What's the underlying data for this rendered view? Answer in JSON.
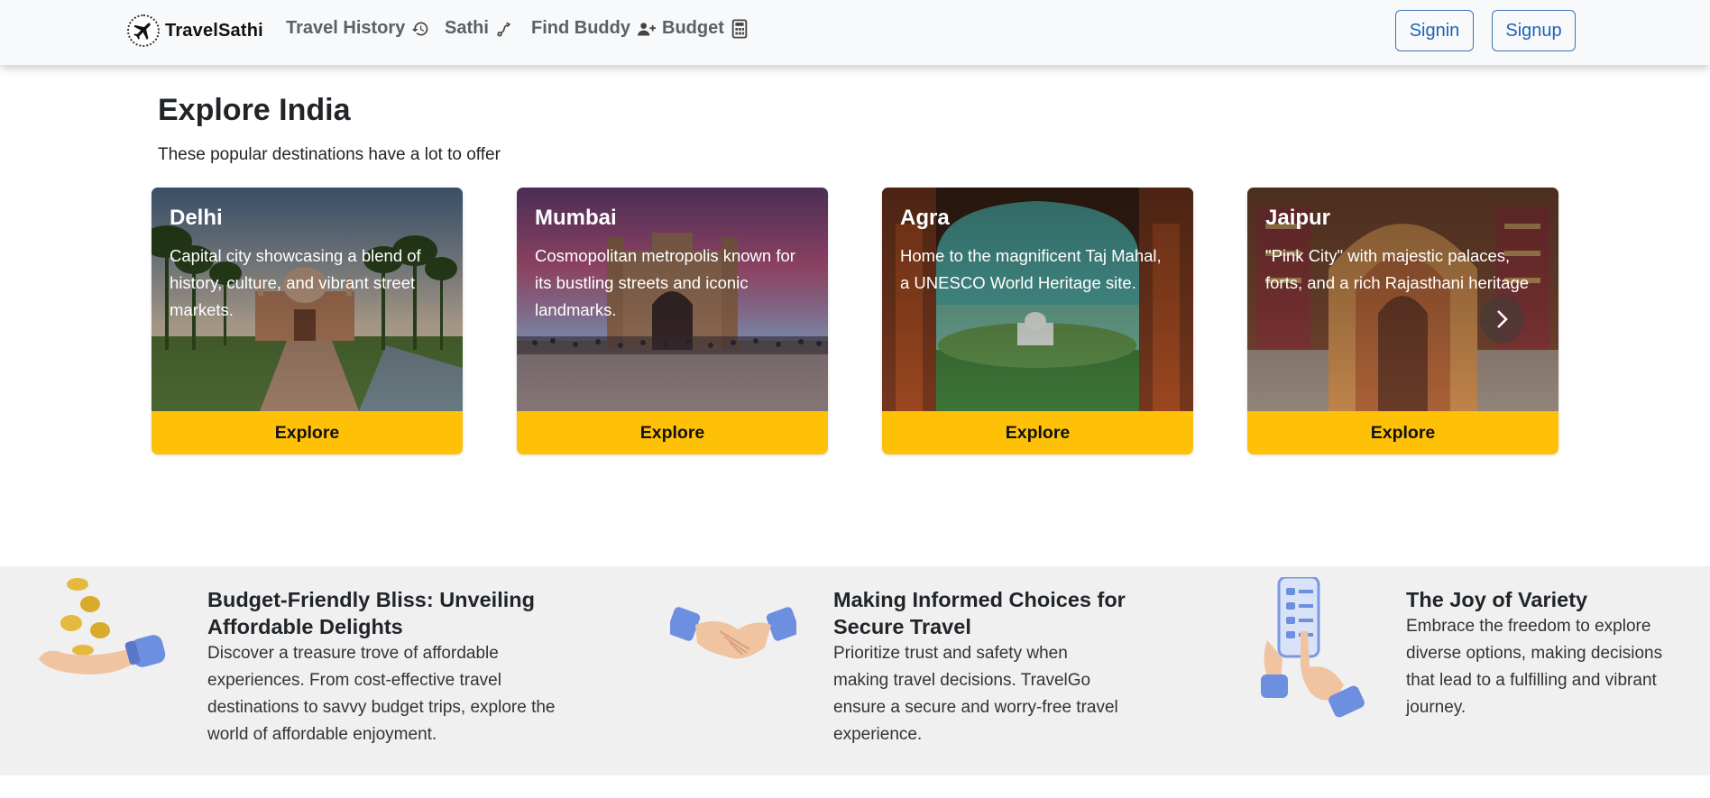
{
  "navbar": {
    "brand": "TravelSathi",
    "links": [
      {
        "label": "Travel History",
        "icon": "history-icon"
      },
      {
        "label": "Sathi",
        "icon": "route-icon"
      },
      {
        "label": "Find Buddy",
        "icon": "person-add-icon"
      },
      {
        "label": "Budget",
        "icon": "calculator-icon"
      }
    ],
    "signin": "Signin",
    "signup": "Signup"
  },
  "hero": {
    "title": "Explore India",
    "subtitle": "These popular destinations have a lot to offer"
  },
  "cards": [
    {
      "title": "Delhi",
      "desc": "Capital city showcasing a blend of history, culture, and vibrant street markets.",
      "button": "Explore"
    },
    {
      "title": "Mumbai",
      "desc": "Cosmopolitan metropolis known for its bustling streets and iconic landmarks.",
      "button": "Explore"
    },
    {
      "title": "Agra",
      "desc": "Home to the magnificent Taj Mahal, a UNESCO World Heritage site.",
      "button": "Explore"
    },
    {
      "title": "Jaipur",
      "desc": "\"Pink City\" with majestic palaces, forts, and a rich Rajasthani heritage",
      "button": "Explore"
    }
  ],
  "features": [
    {
      "title": "Budget-Friendly Bliss: Unveiling Affordable Delights",
      "text": "Discover a treasure trove of affordable experiences. From cost-effective travel destinations to savvy budget trips, explore the world of affordable enjoyment.",
      "icon": "coins-hand-icon"
    },
    {
      "title": "Making Informed Choices for Secure Travel",
      "text": "Prioritize trust and safety when making travel decisions. TravelGo ensure a secure and worry-free travel experience.",
      "icon": "handshake-icon"
    },
    {
      "title": "The Joy of Variety",
      "text": "Embrace the freedom to explore diverse options, making decisions that lead to a fulfilling and vibrant journey.",
      "icon": "phone-checklist-icon"
    }
  ],
  "colors": {
    "accent": "#ffc107",
    "link": "#1e63b8",
    "navbar_bg": "#f8f9fa",
    "features_bg": "#f0f0f0"
  }
}
